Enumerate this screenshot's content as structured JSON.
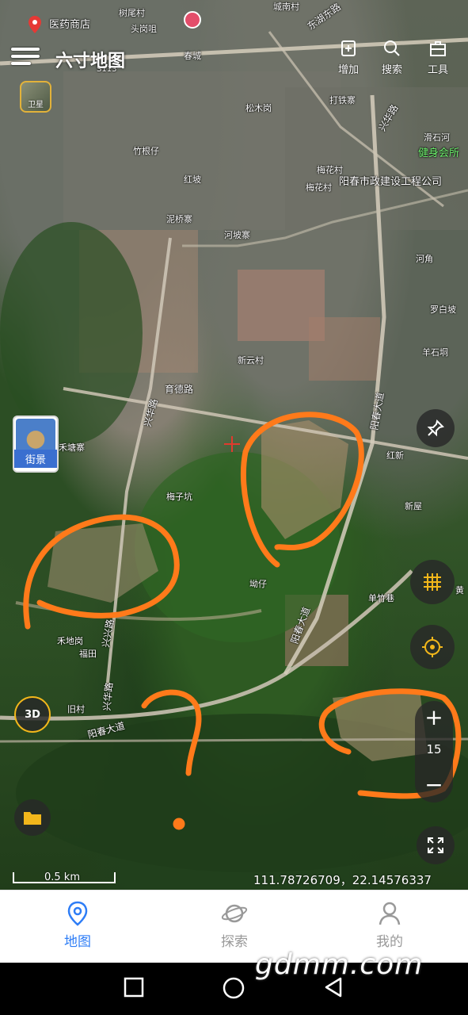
{
  "app": {
    "title": "六寸地图",
    "menu_icon": "menu-icon",
    "tools": [
      {
        "label": "增加",
        "icon": "add-layer-icon"
      },
      {
        "label": "搜索",
        "icon": "search-icon"
      },
      {
        "label": "工具",
        "icon": "toolbox-icon"
      }
    ],
    "layer_label": "卫星"
  },
  "map": {
    "labels": {
      "pharmacy": "医药商店",
      "tree_village": "树尾村",
      "toutang": "头岗咀",
      "s113": "S113",
      "chuncheng": "春城",
      "donghu_east_rd": "东湖东路",
      "chengnan": "城南村",
      "songmu": "松木岗",
      "datie": "打铁寨",
      "xinghua_rd_n": "兴华路",
      "huashihe": "滑石河",
      "gym": "健身会所",
      "zhugen": "竹根仔",
      "hongpo": "红坡",
      "meihua1": "梅花村",
      "meihua2": "梅花村",
      "gov_co": "阳春市政建设工程公司",
      "nigiao": "泥桥寨",
      "hepo": "河坡寨",
      "hejiao": "河角",
      "luobai": "罗白坡",
      "yangshan": "羊石垌",
      "xinyun": "新云村",
      "yude_rd": "育德路",
      "xinghua_rd": "兴华路",
      "yangchun_ave": "阳春大道",
      "hetang": "禾塘寨",
      "hongxin": "红新",
      "meizi": "梅子坑",
      "xinwu": "新屋",
      "aozai": "坳仔",
      "danzhu": "单竹巷",
      "huang": "黄",
      "hedigang": "禾地岗",
      "futian": "福田",
      "xinxing_rd": "兴兴路",
      "jiucun": "旧村",
      "yangchun_ave2": "阳春大道",
      "xinghua_rd2": "兴华路",
      "yangchun_ave3": "阳春大道"
    },
    "street_view_label": "街景",
    "scale": "0.5 km",
    "coordinates": "111.78726709，22.14576337",
    "zoom_level": "15",
    "annotation_color": "#ff7a1a"
  },
  "controls": {
    "pin_icon": "pin-icon",
    "grid_icon": "grid-icon",
    "locate_icon": "locate-icon",
    "three_d_label": "3D",
    "folder_icon": "folder-icon",
    "fullscreen_icon": "fullscreen-icon",
    "zoom_in": "+",
    "zoom_out": "−"
  },
  "bottom_nav": {
    "items": [
      {
        "label": "地图",
        "icon": "map-pin-icon",
        "active": true
      },
      {
        "label": "探索",
        "icon": "planet-icon",
        "active": false
      },
      {
        "label": "我的",
        "icon": "user-icon",
        "active": false
      }
    ]
  },
  "watermark": "gdmm.com",
  "accent": "#2e7df6"
}
